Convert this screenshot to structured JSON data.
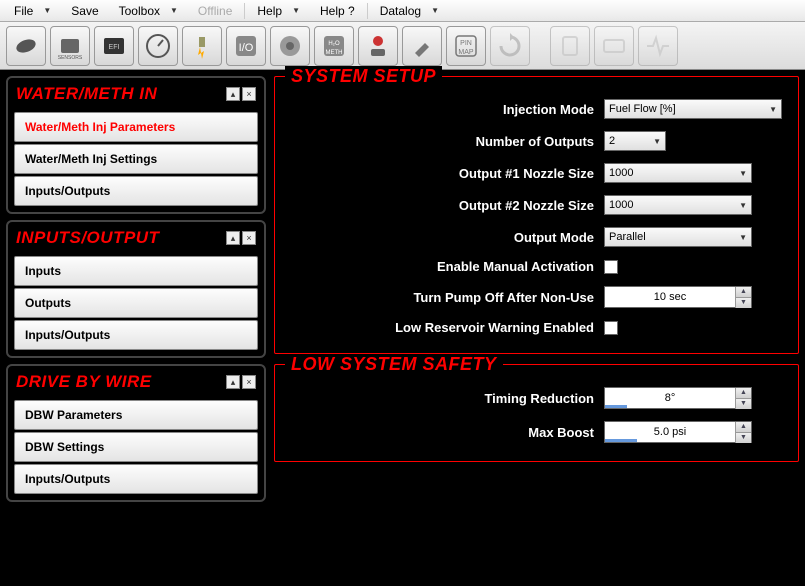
{
  "menu": {
    "file": "File",
    "save": "Save",
    "toolbox": "Toolbox",
    "offline": "Offline",
    "help": "Help",
    "help_q": "Help ?",
    "datalog": "Datalog"
  },
  "sidebar": {
    "water_meth": {
      "title": "WATER/METH IN",
      "items": [
        "Water/Meth Inj Parameters",
        "Water/Meth Inj Settings",
        "Inputs/Outputs"
      ]
    },
    "inputs_output": {
      "title": "INPUTS/OUTPUT",
      "items": [
        "Inputs",
        "Outputs",
        "Inputs/Outputs"
      ]
    },
    "drive_by_wire": {
      "title": "DRIVE BY WIRE",
      "items": [
        "DBW Parameters",
        "DBW Settings",
        "Inputs/Outputs"
      ]
    }
  },
  "system_setup": {
    "title": "SYSTEM SETUP",
    "injection_mode": {
      "label": "Injection Mode",
      "value": "Fuel Flow [%]"
    },
    "num_outputs": {
      "label": "Number of Outputs",
      "value": "2"
    },
    "nozzle1": {
      "label": "Output #1 Nozzle Size",
      "value": "1000"
    },
    "nozzle2": {
      "label": "Output #2 Nozzle Size",
      "value": "1000"
    },
    "output_mode": {
      "label": "Output Mode",
      "value": "Parallel"
    },
    "enable_manual": {
      "label": "Enable Manual Activation"
    },
    "pump_off": {
      "label": "Turn Pump Off After Non-Use",
      "value": "10 sec"
    },
    "low_reservoir": {
      "label": "Low Reservoir Warning Enabled"
    }
  },
  "low_safety": {
    "title": "LOW SYSTEM SAFETY",
    "timing": {
      "label": "Timing Reduction",
      "value": "8°"
    },
    "max_boost": {
      "label": "Max Boost",
      "value": "5.0 psi"
    }
  }
}
